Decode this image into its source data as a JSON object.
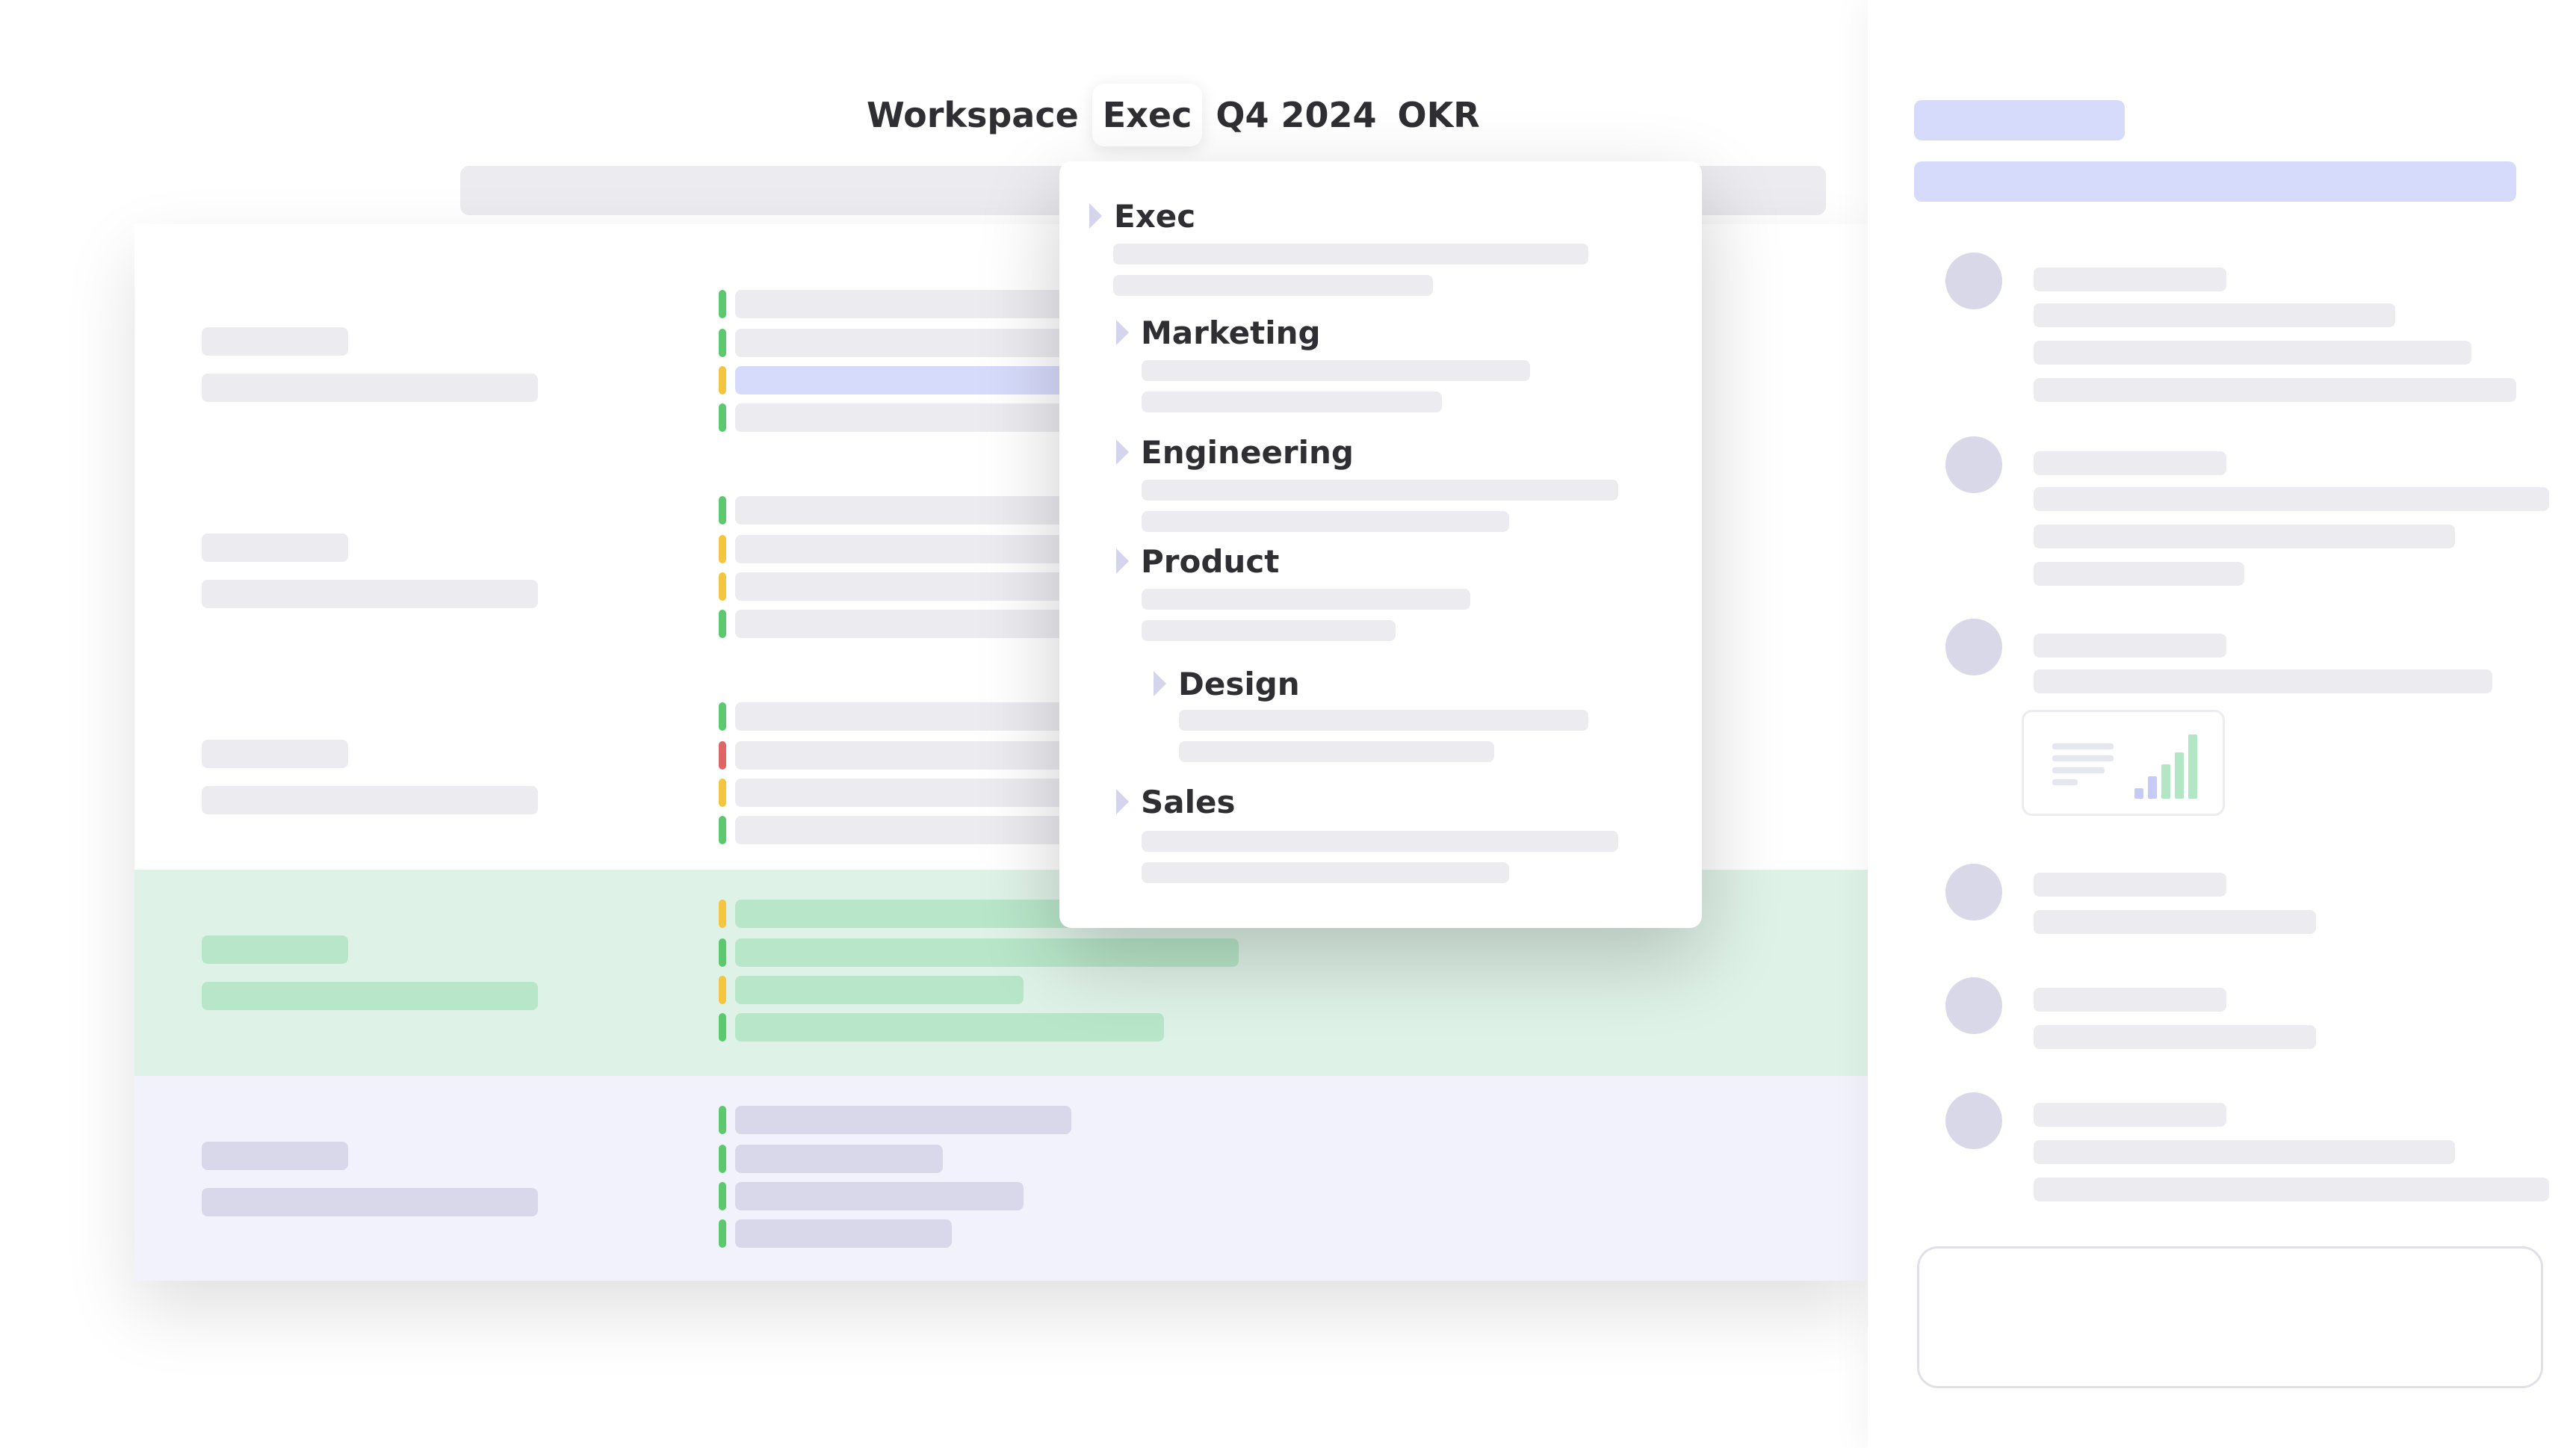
{
  "breadcrumb": [
    "Workspace",
    "Exec",
    "Q4 2024",
    "OKR"
  ],
  "breadcrumb_active_index": 1,
  "tree": [
    "Exec",
    "Marketing",
    "Engineering",
    "Product",
    "Design",
    "Sales"
  ],
  "colors": {
    "status_green": "#5cc96f",
    "status_yellow": "#f4c640",
    "status_red": "#e06565",
    "highlight_purple": "#d7dbfb",
    "band_green": "#dff2e7",
    "band_purple": "#f2f2fc"
  },
  "board_groups": [
    {
      "statuses": [
        "green",
        "green",
        "yellow",
        "green"
      ]
    },
    {
      "statuses": [
        "green",
        "yellow",
        "yellow",
        "green"
      ]
    },
    {
      "statuses": [
        "green",
        "red",
        "yellow",
        "green"
      ]
    },
    {
      "statuses": [
        "yellow",
        "green",
        "yellow",
        "green"
      ]
    },
    {
      "statuses": [
        "green",
        "green",
        "green",
        "green"
      ]
    }
  ],
  "icons": [
    "caret-right-icon",
    "bar-chart-icon",
    "avatar-icon"
  ]
}
